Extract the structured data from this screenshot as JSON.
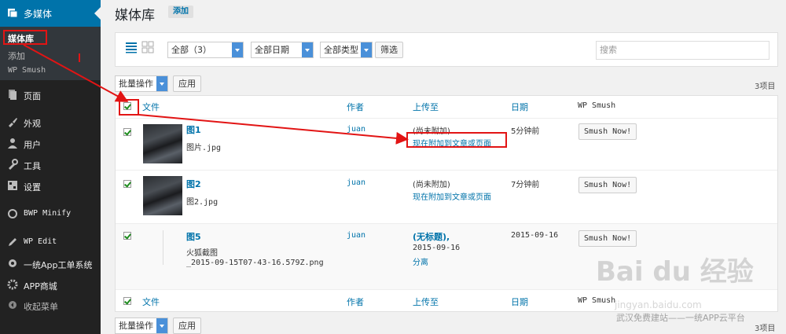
{
  "sidebar": {
    "header": "多媒体",
    "submenu": [
      "媒体库",
      "添加",
      "WP Smush"
    ],
    "items": [
      "页面",
      "外观",
      "用户",
      "工具",
      "设置",
      "BWP Minify",
      "WP Edit",
      "一统App工单系统",
      "APP商城",
      "收起菜单"
    ]
  },
  "page": {
    "title": "媒体库",
    "add_label": "添加"
  },
  "filters": {
    "all": "全部（3）",
    "dates": "全部日期",
    "types": "全部类型",
    "filter_button": "筛选",
    "search_placeholder": "搜索"
  },
  "bulk": {
    "label": "批量操作",
    "apply": "应用",
    "count": "3项目"
  },
  "table": {
    "headers": {
      "file": "文件",
      "author": "作者",
      "uploaded_to": "上传至",
      "date": "日期",
      "smush": "WP Smush"
    },
    "rows": [
      {
        "title": "图1",
        "filename": "图片.jpg",
        "author": "juan",
        "attached": "(尚未附加)",
        "attach_link": "现在附加到文章或页面",
        "date": "5分钟前",
        "smush": "Smush Now!"
      },
      {
        "title": "图2",
        "filename": "图2.jpg",
        "author": "juan",
        "attached": "(尚未附加)",
        "attach_link": "现在附加到文章或页面",
        "date": "7分钟前",
        "smush": "Smush Now!"
      },
      {
        "title": "图5",
        "filename": "火狐截图",
        "filename2": "_2015-09-15T07-43-16.579Z.png",
        "author": "juan",
        "attached": "(无标题),",
        "attached_date": "2015-09-16",
        "detach": "分离",
        "date": "2015-09-16",
        "smush": "Smush Now!"
      }
    ]
  },
  "watermark": {
    "logo": "Bai du 经验",
    "url": "jingyan.baidu.com",
    "caption": "武汉免费建站——一统APP云平台"
  },
  "colors": {
    "accent": "#0073aa",
    "sidebar": "#222222",
    "highlight": "#e21414"
  }
}
